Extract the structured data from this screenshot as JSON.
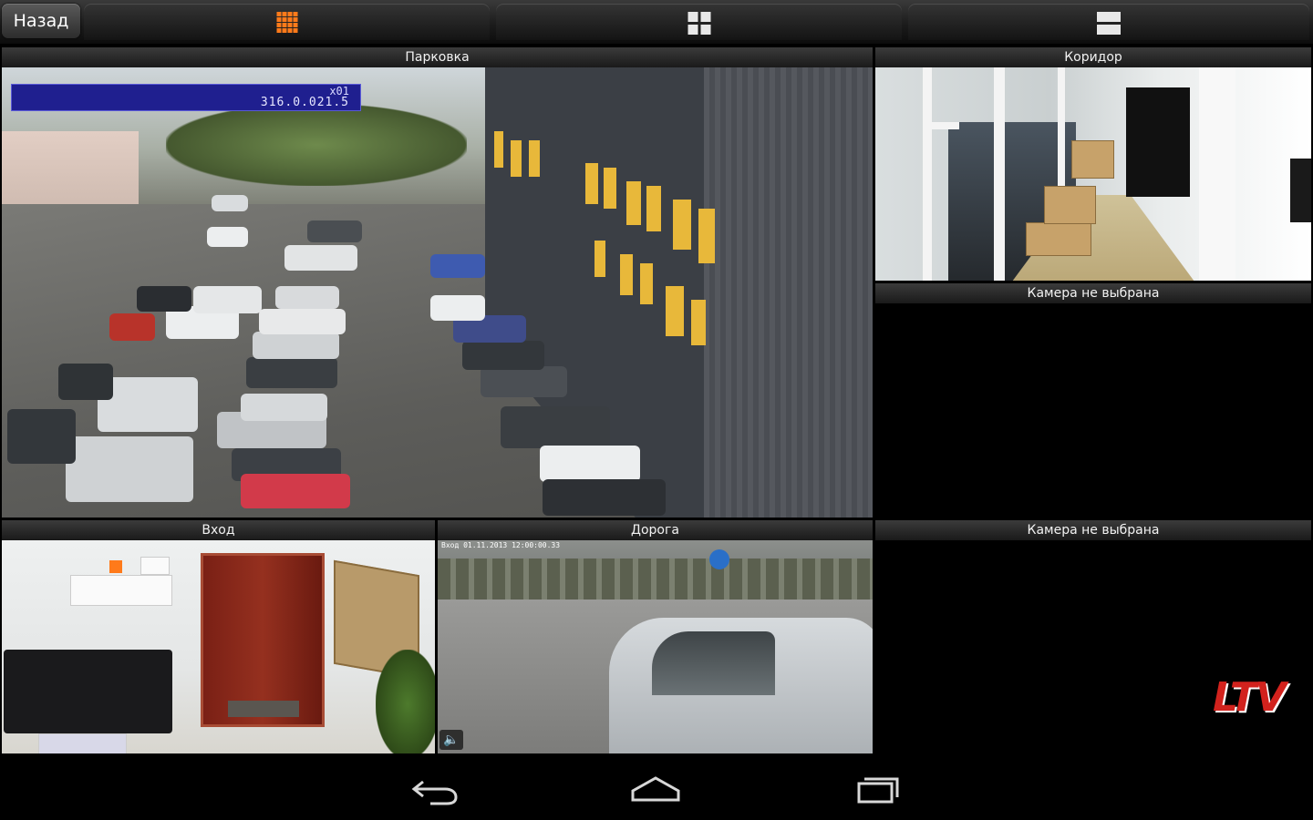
{
  "toolbar": {
    "back_label": "Назад",
    "layouts": [
      {
        "name": "grid-16",
        "icon": "grid-16-icon",
        "active": true,
        "color": "#ff7a1a"
      },
      {
        "name": "grid-4",
        "icon": "grid-4-icon",
        "active": false,
        "color": "#e8e8e8"
      },
      {
        "name": "grid-2",
        "icon": "grid-2-icon",
        "active": false,
        "color": "#e8e8e8"
      }
    ]
  },
  "cameras": {
    "parking": {
      "title": "Парковка",
      "osd_line1": "x01",
      "osd_line2": "316.0.021.5"
    },
    "corridor": {
      "title": "Коридор"
    },
    "empty_1": {
      "title": "Камера не выбрана"
    },
    "entrance": {
      "title": "Вход"
    },
    "road": {
      "title": "Дорога",
      "osd": "Вход 01.11.2013 12:00:00.33"
    },
    "empty_2": {
      "title": "Камера не выбрана"
    }
  },
  "brand": {
    "logo_text": "LTV",
    "color": "#d2221d"
  },
  "navbar": {
    "back_icon": "back-icon",
    "home_icon": "home-icon",
    "recent_icon": "recent-apps-icon"
  }
}
